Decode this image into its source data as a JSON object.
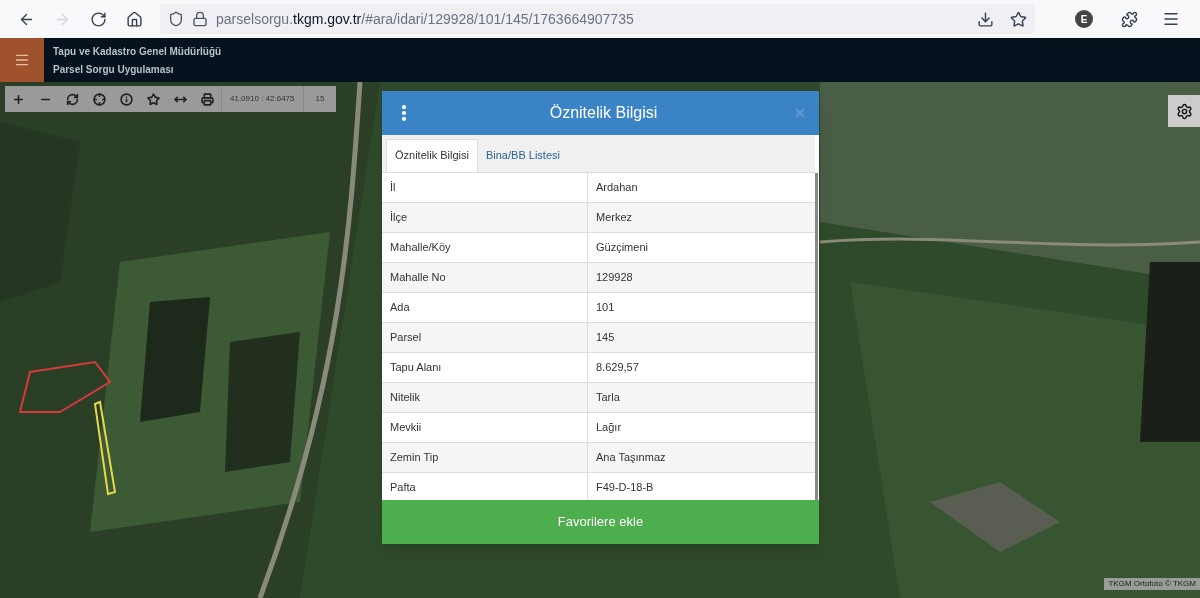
{
  "browser": {
    "nav": [
      {
        "kind": "back",
        "disabled": false
      },
      {
        "kind": "forward",
        "disabled": true
      },
      {
        "kind": "reload",
        "disabled": false
      },
      {
        "kind": "home",
        "disabled": false
      }
    ],
    "url": "parselsorgu.**tkgm.gov.tr**/#ara/idari/129928/101/145/1763664907735",
    "profile": "E"
  },
  "header": {
    "title": "Tapu ve Kadastro Genel Müdürlüğü",
    "subtitle": "Parsel Sorgu Uygulaması"
  },
  "map_toolbar": {
    "tools": [
      {
        "kind": "zoom-in"
      },
      {
        "kind": "zoom-out"
      },
      {
        "kind": "refresh"
      },
      {
        "kind": "locate"
      },
      {
        "kind": "info"
      },
      {
        "kind": "favorite"
      },
      {
        "kind": "measure"
      },
      {
        "kind": "print"
      }
    ],
    "coordinates": "41.0910 : 42.6475",
    "zoom": "15"
  },
  "attribution": "TKGM Ortofoto © TKGM",
  "dialog": {
    "title": "Öznitelik Bilgisi",
    "tabs": [
      {
        "label": "Öznitelik Bilgisi",
        "selected": true
      },
      {
        "label": "Bina/BB Listesi",
        "selected": false
      }
    ],
    "rows": [
      {
        "label": "İl",
        "value": "Ardahan"
      },
      {
        "label": "İlçe",
        "value": "Merkez"
      },
      {
        "label": "Mahalle/Köy",
        "value": "Güzçimeni"
      },
      {
        "label": "Mahalle No",
        "value": "129928"
      },
      {
        "label": "Ada",
        "value": "101"
      },
      {
        "label": "Parsel",
        "value": "145"
      },
      {
        "label": "Tapu Alanı",
        "value": "8.629,57"
      },
      {
        "label": "Nitelik",
        "value": "Tarla"
      },
      {
        "label": "Mevkii",
        "value": "Lağır"
      },
      {
        "label": "Zemin Tip",
        "value": "Ana Taşınmaz"
      },
      {
        "label": "Pafta",
        "value": "F49-D-18-B"
      }
    ],
    "action": "Favorilere ekle"
  }
}
